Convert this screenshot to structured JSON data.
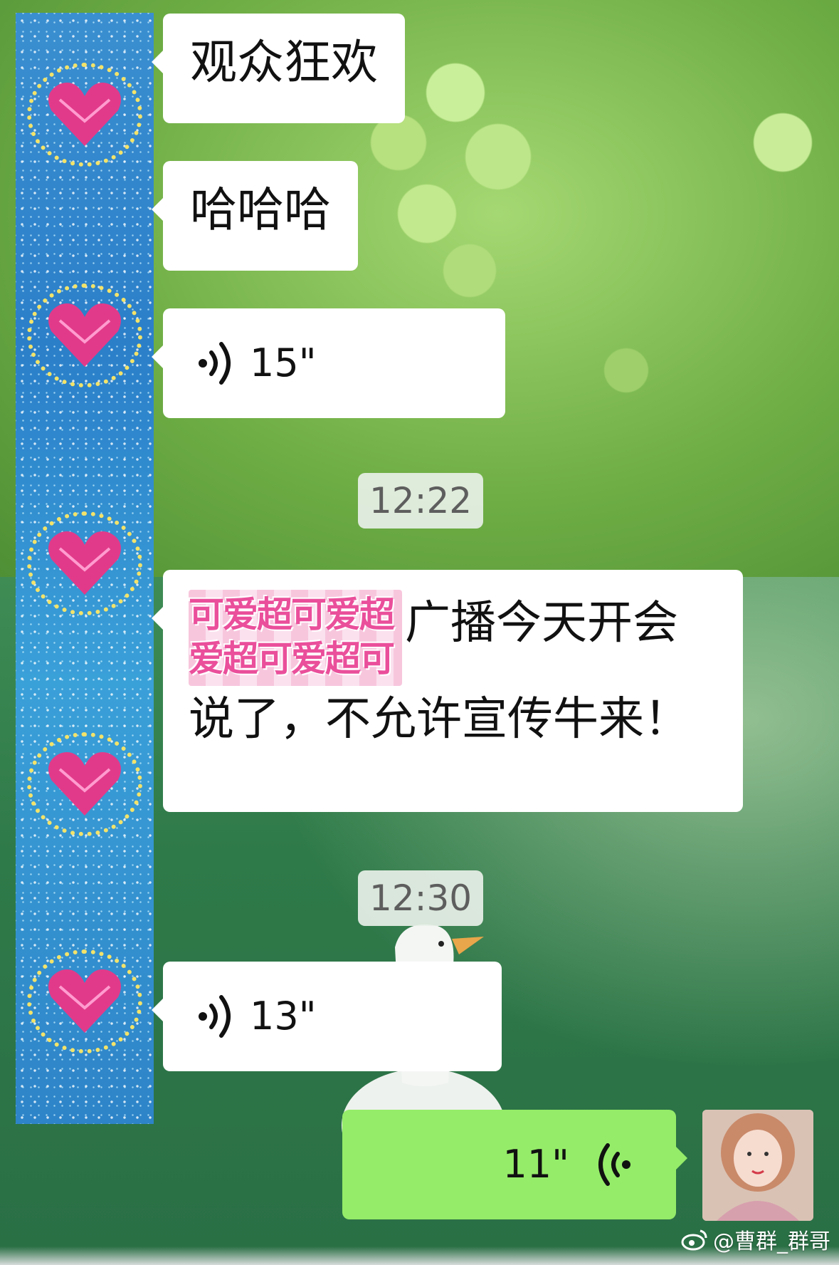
{
  "chat": {
    "messages": [
      {
        "type": "text",
        "side": "left",
        "text": "观众狂欢"
      },
      {
        "type": "text",
        "side": "left",
        "text": "哈哈哈"
      },
      {
        "type": "voice",
        "side": "left",
        "duration": "15\""
      },
      {
        "type": "time",
        "text": "12:22"
      },
      {
        "type": "text_with_sticker",
        "side": "left",
        "sticker_lines": [
          "可爱超可爱超",
          "爱超可爱超可"
        ],
        "text": "广播今天开会说了，不允许宣传牛来！"
      },
      {
        "type": "time",
        "text": "12:30"
      },
      {
        "type": "voice",
        "side": "left",
        "duration": "13\""
      },
      {
        "type": "voice",
        "side": "right",
        "duration": "11\""
      }
    ]
  },
  "watermark": {
    "text": "@曹群_群哥",
    "icon": "weibo-icon"
  },
  "colors": {
    "bubble_left": "#ffffff",
    "bubble_right": "#95ec69",
    "strip": "#2b7fc9",
    "heart": "#e23a8a"
  }
}
